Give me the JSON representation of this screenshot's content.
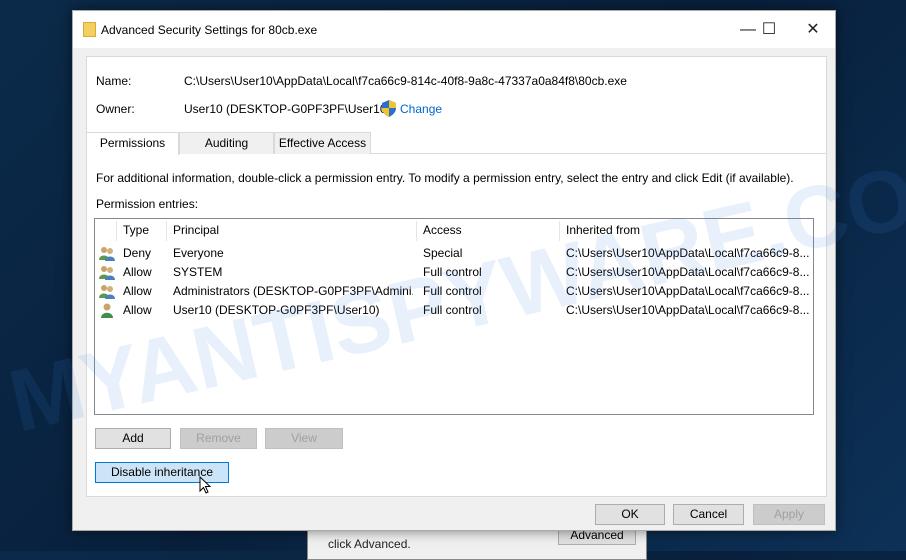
{
  "background_dialog": {
    "text": "click Advanced.",
    "advanced_button": "Advanced"
  },
  "window": {
    "title": "Advanced Security Settings for 80cb.exe",
    "minimize": "—",
    "maximize": "☐",
    "close": "✕"
  },
  "info": {
    "name_label": "Name:",
    "name_value": "C:\\Users\\User10\\AppData\\Local\\f7ca66c9-814c-40f8-9a8c-47337a0a84f8\\80cb.exe",
    "owner_label": "Owner:",
    "owner_value": "User10 (DESKTOP-G0PF3PF\\User10)",
    "change_link": "Change"
  },
  "tabs": [
    {
      "label": "Permissions",
      "active": true
    },
    {
      "label": "Auditing"
    },
    {
      "label": "Effective Access"
    }
  ],
  "permissions": {
    "instructions": "For additional information, double-click a permission entry. To modify a permission entry, select the entry and click Edit (if available).",
    "entries_label": "Permission entries:",
    "columns": [
      "Type",
      "Principal",
      "Access",
      "Inherited from"
    ],
    "rows": [
      {
        "icon": "group-users-icon",
        "type": "Deny",
        "principal": "Everyone",
        "access": "Special",
        "inherited": "C:\\Users\\User10\\AppData\\Local\\f7ca66c9-8..."
      },
      {
        "icon": "group-users-icon",
        "type": "Allow",
        "principal": "SYSTEM",
        "access": "Full control",
        "inherited": "C:\\Users\\User10\\AppData\\Local\\f7ca66c9-8..."
      },
      {
        "icon": "group-users-icon",
        "type": "Allow",
        "principal": "Administrators (DESKTOP-G0PF3PF\\Admini...",
        "access": "Full control",
        "inherited": "C:\\Users\\User10\\AppData\\Local\\f7ca66c9-8..."
      },
      {
        "icon": "single-user-icon",
        "type": "Allow",
        "principal": "User10 (DESKTOP-G0PF3PF\\User10)",
        "access": "Full control",
        "inherited": "C:\\Users\\User10\\AppData\\Local\\f7ca66c9-8..."
      }
    ],
    "add": "Add",
    "remove": "Remove",
    "view": "View",
    "disable_inheritance": "Disable inheritance"
  },
  "footer": {
    "ok": "OK",
    "cancel": "Cancel",
    "apply": "Apply"
  },
  "watermark": "MYANTISPYWARE.COM"
}
